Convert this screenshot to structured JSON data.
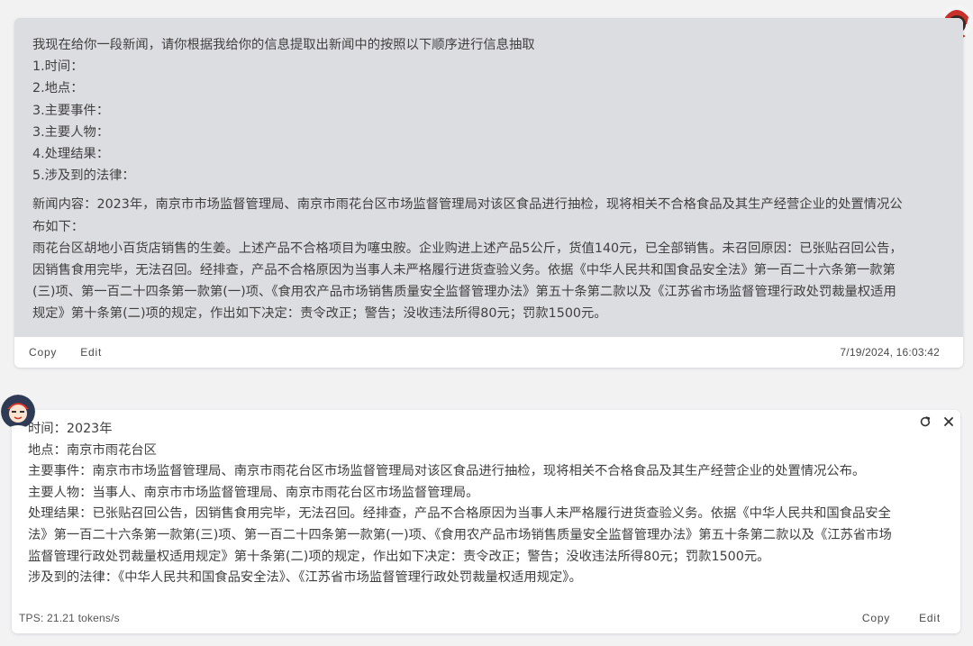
{
  "user_message": {
    "lines": [
      "我现在给你一段新闻，请你根据我给你的信息提取出新闻中的按照以下顺序进行信息抽取",
      "1.时间：",
      "2.地点：",
      "3.主要事件：",
      "3.主要人物：",
      "4.处理结果：",
      "5.涉及到的法律："
    ],
    "news_lines": [
      "新闻内容：2023年，南京市市场监督管理局、南京市雨花台区市场监督管理局对该区食品进行抽检，现将相关不合格食品及其生产经营企业的处置情况公",
      "布如下：",
      "雨花台区胡地小百货店销售的生姜。上述产品不合格项目为噻虫胺。企业购进上述产品5公斤，货值140元，已全部销售。未召回原因：已张贴召回公告，",
      "因销售食用完毕，无法召回。经排查，产品不合格原因为当事人未严格履行进货查验义务。依据《中华人民共和国食品安全法》第一百二十六条第一款第",
      "(三)项、第一百二十四条第一款第(一)项、《食用农产品市场销售质量安全监督管理办法》第五十条第二款以及《江苏省市场监督管理行政处罚裁量权适用",
      "规定》第十条第(二)项的规定，作出如下决定：责令改正；警告；没收违法所得80元；罚款1500元。"
    ],
    "copy_label": "Copy",
    "edit_label": "Edit",
    "timestamp": "7/19/2024, 16:03:42"
  },
  "bot_message": {
    "lines": [
      "时间：2023年",
      "地点：南京市雨花台区",
      "主要事件：南京市市场监督管理局、南京市雨花台区市场监督管理局对该区食品进行抽检，现将相关不合格食品及其生产经营企业的处置情况公布。",
      "主要人物：当事人、南京市市场监督管理局、南京市雨花台区市场监督管理局。",
      "处理结果：已张贴召回公告，因销售食用完毕，无法召回。经排查，产品不合格原因为当事人未严格履行进货查验义务。依据《中华人民共和国食品安全",
      "法》第一百二十六条第一款第(三)项、第一百二十四条第一款第(一)项、《食用农产品市场销售质量安全监督管理办法》第五十条第二款以及《江苏省市场",
      "监督管理行政处罚裁量权适用规定》第十条第(二)项的规定，作出如下决定：责令改正；警告；没收违法所得80元；罚款1500元。",
      "涉及到的法律：《中华人民共和国食品安全法》、《江苏省市场监督管理行政处罚裁量权适用规定》。"
    ],
    "tps": "TPS: 21.21 tokens/s",
    "copy_label": "Copy",
    "edit_label": "Edit"
  },
  "icons": {
    "regenerate": "refresh-icon",
    "close": "close-icon",
    "user_avatar": "user-avatar",
    "bot_avatar": "bot-avatar"
  },
  "colors": {
    "page_bg": "#f2f2f3",
    "user_bubble": "#dcdde1",
    "card": "#ffffff",
    "text": "#404040"
  }
}
